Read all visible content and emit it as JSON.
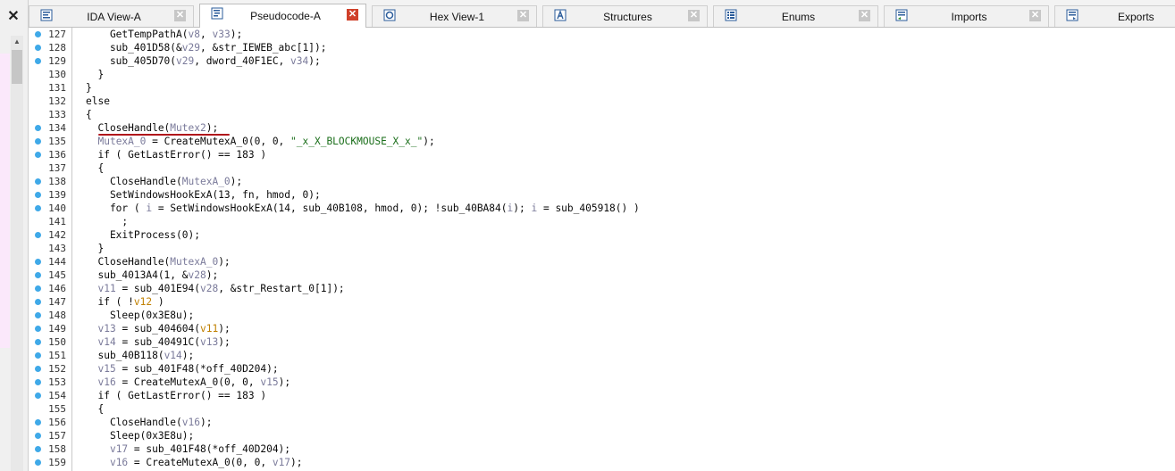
{
  "close_symbol": "✕",
  "tabs": [
    {
      "label": "IDA View-A",
      "icon": "disassembly-view-icon",
      "active": false
    },
    {
      "label": "Pseudocode-A",
      "icon": "pseudocode-view-icon",
      "active": true
    },
    {
      "label": "Hex View-1",
      "icon": "hex-view-icon",
      "active": false
    },
    {
      "label": "Structures",
      "icon": "structures-icon",
      "active": false
    },
    {
      "label": "Enums",
      "icon": "enums-icon",
      "active": false
    },
    {
      "label": "Imports",
      "icon": "imports-icon",
      "active": false
    },
    {
      "label": "Exports",
      "icon": "exports-icon",
      "active": false
    }
  ],
  "lines": [
    {
      "n": "127",
      "dot": true,
      "code": "    GetTempPathA(v8, v33);"
    },
    {
      "n": "128",
      "dot": true,
      "code": "    sub_401D58(&v29, &str_IEWEB_abc[1]);"
    },
    {
      "n": "129",
      "dot": true,
      "code": "    sub_405D70(v29, dword_40F1EC, v34);"
    },
    {
      "n": "130",
      "dot": false,
      "code": "  }"
    },
    {
      "n": "131",
      "dot": false,
      "code": "}"
    },
    {
      "n": "132",
      "dot": false,
      "code": "else"
    },
    {
      "n": "133",
      "dot": false,
      "code": "{"
    },
    {
      "n": "134",
      "dot": true,
      "code": "  CloseHandle(Mutex2);"
    },
    {
      "n": "135",
      "dot": true,
      "code": "  MutexA_0 = CreateMutexA_0(0, 0, \"_x_X_BLOCKMOUSE_X_x_\");"
    },
    {
      "n": "136",
      "dot": true,
      "code": "  if ( GetLastError() == 183 )"
    },
    {
      "n": "137",
      "dot": false,
      "code": "  {"
    },
    {
      "n": "138",
      "dot": true,
      "code": "    CloseHandle(MutexA_0);"
    },
    {
      "n": "139",
      "dot": true,
      "code": "    SetWindowsHookExA(13, fn, hmod, 0);"
    },
    {
      "n": "140",
      "dot": true,
      "code": "    for ( i = SetWindowsHookExA(14, sub_40B108, hmod, 0); !sub_40BA84(i); i = sub_405918() )"
    },
    {
      "n": "141",
      "dot": false,
      "code": "      ;"
    },
    {
      "n": "142",
      "dot": true,
      "code": "    ExitProcess(0);"
    },
    {
      "n": "143",
      "dot": false,
      "code": "  }"
    },
    {
      "n": "144",
      "dot": true,
      "code": "  CloseHandle(MutexA_0);"
    },
    {
      "n": "145",
      "dot": true,
      "code": "  sub_4013A4(1, &v28);"
    },
    {
      "n": "146",
      "dot": true,
      "code": "  v11 = sub_401E94(v28, &str_Restart_0[1]);"
    },
    {
      "n": "147",
      "dot": true,
      "code": "  if ( !v12 )"
    },
    {
      "n": "148",
      "dot": true,
      "code": "    Sleep(0x3E8u);"
    },
    {
      "n": "149",
      "dot": true,
      "code": "  v13 = sub_404604(v11);"
    },
    {
      "n": "150",
      "dot": true,
      "code": "  v14 = sub_40491C(v13);"
    },
    {
      "n": "151",
      "dot": true,
      "code": "  sub_40B118(v14);"
    },
    {
      "n": "152",
      "dot": true,
      "code": "  v15 = sub_401F48(*off_40D204);"
    },
    {
      "n": "153",
      "dot": true,
      "code": "  v16 = CreateMutexA_0(0, 0, v15);"
    },
    {
      "n": "154",
      "dot": true,
      "code": "  if ( GetLastError() == 183 )"
    },
    {
      "n": "155",
      "dot": false,
      "code": "  {"
    },
    {
      "n": "156",
      "dot": true,
      "code": "    CloseHandle(v16);"
    },
    {
      "n": "157",
      "dot": true,
      "code": "    Sleep(0x3E8u);"
    },
    {
      "n": "158",
      "dot": true,
      "code": "    v17 = sub_401F48(*off_40D204);"
    },
    {
      "n": "159",
      "dot": true,
      "code": "    v16 = CreateMutexA_0(0, 0, v17);"
    }
  ],
  "colors": {
    "breakpoint_dot": "#3fa9e8",
    "variable": "#7a7a9a",
    "string": "#1a6e1a",
    "highlight_var": "#c08000",
    "annotation_underline": "#b0141b",
    "active_tab_close": "#d0402a"
  }
}
